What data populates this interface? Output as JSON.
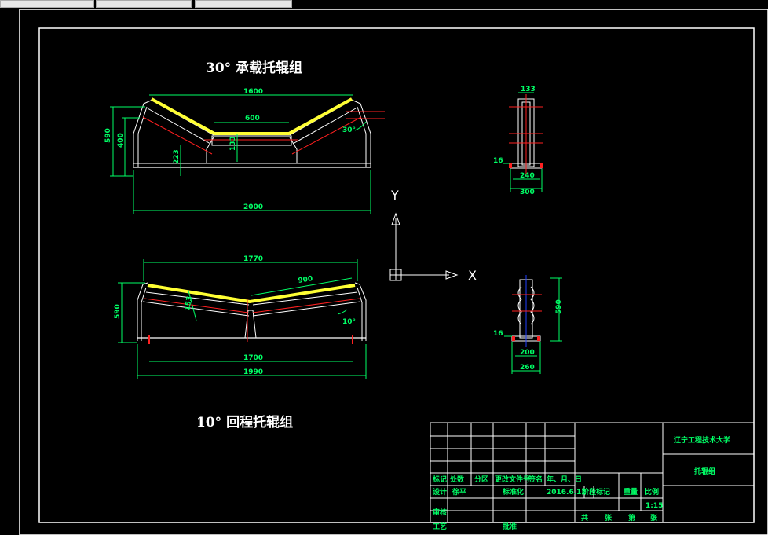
{
  "colors": {
    "background": "#000000",
    "frame": "#ffffff",
    "dimension": "#00ff66",
    "belt": "#ffff33",
    "centerline": "#ff2020",
    "blue": "#2040ff"
  },
  "views": {
    "carrying_title": "30° 承载托辊组",
    "return_title": "10° 回程托辊组"
  },
  "carrying_dims": {
    "w1600": "1600",
    "w600": "600",
    "h590": "590",
    "h400": "400",
    "h223": "223",
    "h133": "133",
    "w2000": "2000",
    "angle30": "30°"
  },
  "return_dims": {
    "w1770": "1770",
    "w900": "900",
    "h590": "590",
    "d153": "153",
    "angle10": "10°",
    "w1700": "1700",
    "w1990": "1990"
  },
  "side_dims": {
    "top133": "133",
    "h16a": "16",
    "w240": "240",
    "w300": "300",
    "h16b": "16",
    "h590": "590",
    "w200": "200",
    "w260": "260"
  },
  "ucs": {
    "y_label": "Y",
    "x_label": "X"
  },
  "title_block": {
    "school": "辽宁工程技术大学",
    "drawing_name": "托辊组",
    "row_labels": [
      "标记",
      "处数",
      "分区",
      "更改文件号",
      "签名",
      "年、月、日"
    ],
    "design_label": "设计",
    "designer": "徐平",
    "std_label": "标准化",
    "date": "2016.6.12",
    "stage_label": "阶段标记",
    "weight_label": "重量",
    "scale_label": "比例",
    "scale": "1:15",
    "review_label": "审核",
    "process_label": "工艺",
    "approve_label": "批准",
    "sheet_total": "共",
    "sheet_unit1": "张",
    "sheet_no": "第",
    "sheet_unit2": "张"
  }
}
